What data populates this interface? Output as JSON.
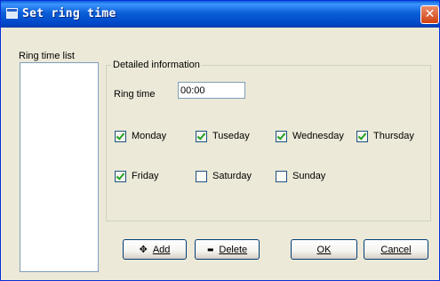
{
  "window": {
    "title": "Set ring time",
    "close_glyph": "✕"
  },
  "list": {
    "label": "Ring time list",
    "items": []
  },
  "details": {
    "group_title": "Detailed information",
    "ring_time_label": "Ring time",
    "ring_time_value": "00:00"
  },
  "days": [
    {
      "label": "Monday",
      "checked": true
    },
    {
      "label": "Tuseday",
      "checked": true
    },
    {
      "label": "Wednesday",
      "checked": true
    },
    {
      "label": "Thursday",
      "checked": true
    },
    {
      "label": "Friday",
      "checked": true
    },
    {
      "label": "Saturday",
      "checked": false
    },
    {
      "label": "Sunday",
      "checked": false
    }
  ],
  "buttons": {
    "add": {
      "label": "Add",
      "icon": "plus-icon",
      "glyph": "✥"
    },
    "delete": {
      "label": "Delete",
      "icon": "minus-icon",
      "glyph": "▬"
    },
    "ok": {
      "label": "OK"
    },
    "cancel": {
      "label": "Cancel"
    }
  }
}
